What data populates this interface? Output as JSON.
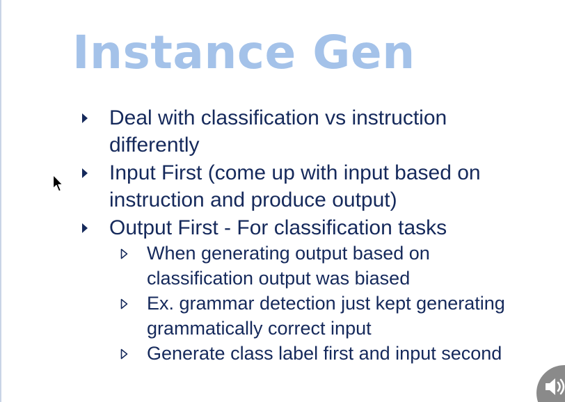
{
  "slide": {
    "title": "Instance Gen",
    "bullets": [
      {
        "lines": [
          "Deal with classification vs instruction",
          "differently"
        ]
      },
      {
        "lines": [
          "Input First (come up with input based on",
          "instruction and produce output)"
        ]
      },
      {
        "lines": [
          "Output First - For classification tasks"
        ],
        "sub_bullets": [
          {
            "lines": [
              "When generating output based on",
              "classification output was biased"
            ]
          },
          {
            "lines": [
              "Ex. grammar detection just kept generating",
              "grammatically correct input"
            ]
          },
          {
            "lines": [
              "Generate class label first and input second"
            ]
          }
        ]
      }
    ]
  },
  "icons": {
    "bullet_level1": "solid-triangle-right-icon",
    "bullet_level2": "hollow-triangle-right-icon",
    "pointer": "mouse-cursor-icon",
    "audio": "speaker-icon"
  },
  "colors": {
    "title": "#a4c2e9",
    "body_text": "#15295b",
    "audio_button": "#8a8a8a"
  }
}
